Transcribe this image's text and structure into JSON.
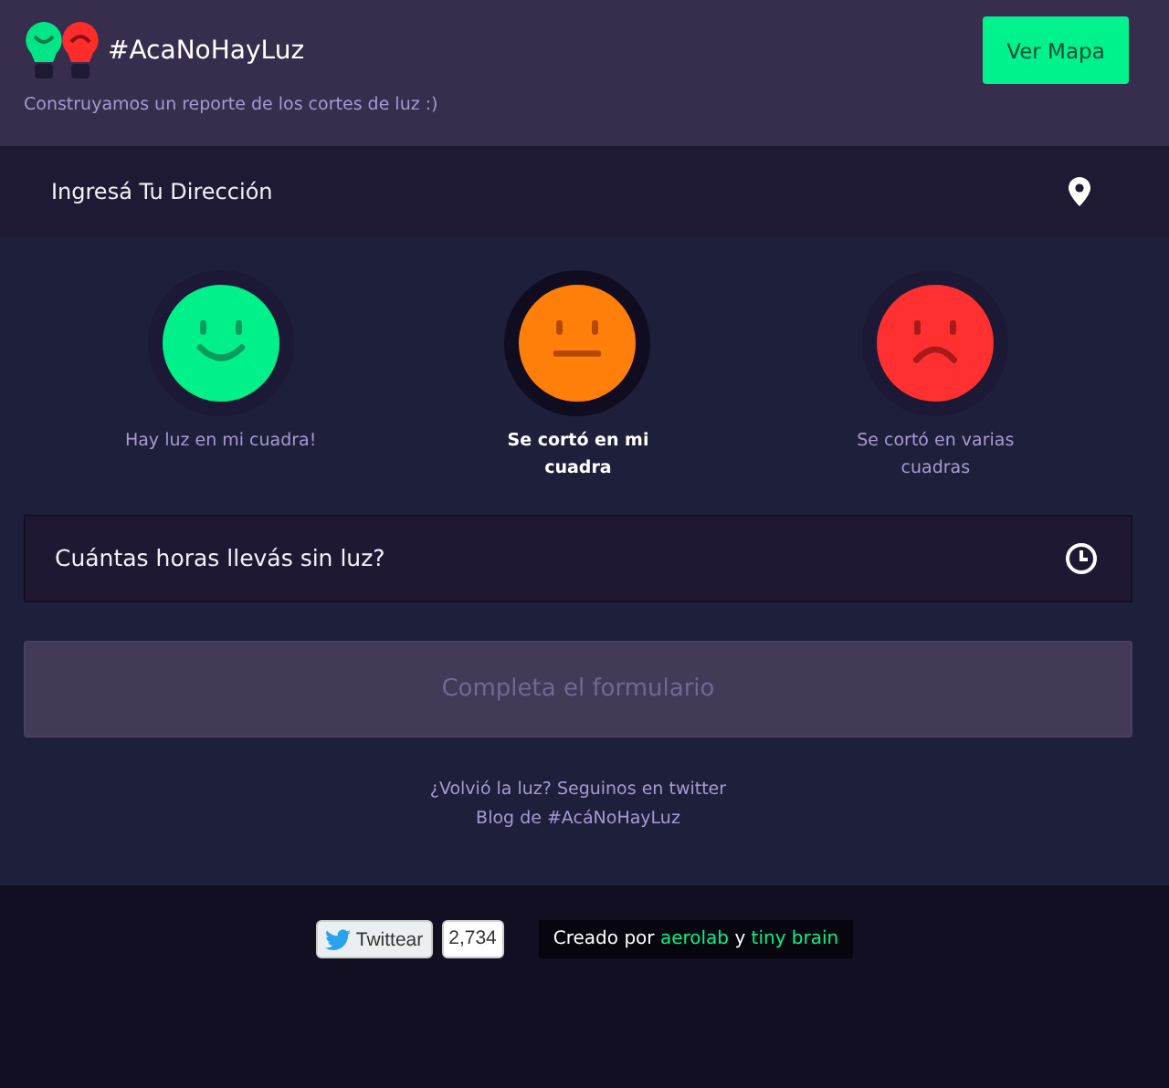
{
  "header": {
    "title": "#AcaNoHayLuz",
    "subtitle": "Construyamos un reporte de los cortes de luz :)",
    "button": "Ver Mapa"
  },
  "address": {
    "placeholder": "Ingresá Tu Dirección"
  },
  "options": [
    {
      "kind": "happy",
      "color": "#00f08a",
      "label": "Hay luz en mi cuadra!",
      "selected": false
    },
    {
      "kind": "neutral",
      "color": "#ff7f0a",
      "label": "Se cortó en mi cuadra",
      "selected": true
    },
    {
      "kind": "sad",
      "color": "#ff302f",
      "label": "Se cortó en varias cuadras",
      "selected": false
    }
  ],
  "hours": {
    "placeholder": "Cuántas horas llevás sin luz?"
  },
  "submit": {
    "label": "Completa el formulario",
    "disabled": true
  },
  "links": [
    "¿Volvió la luz? Seguinos en twitter",
    "Blog de #AcáNoHayLuz"
  ],
  "footer": {
    "tweet": "Twittear",
    "count": "2,734",
    "credits_prefix": "Creado por",
    "credits_links": [
      "aerolab",
      "tiny brain"
    ],
    "credits_joiner": "y"
  }
}
